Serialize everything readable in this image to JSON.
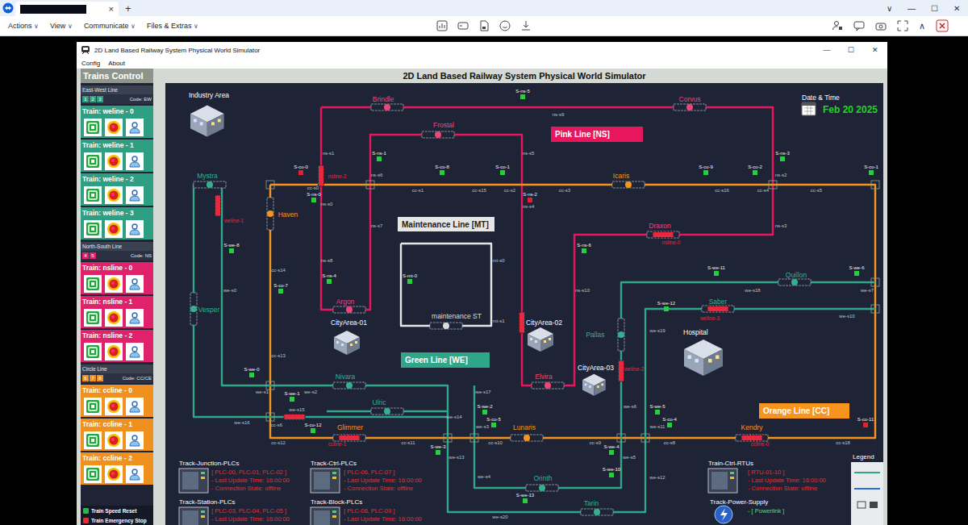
{
  "app_bar": {
    "tab_close": "×",
    "tab_add": "+",
    "window_controls": [
      "∨",
      "—",
      "☐",
      "✕"
    ],
    "menus": [
      {
        "label": "Actions",
        "caret": "∨"
      },
      {
        "label": "View",
        "caret": "∨"
      },
      {
        "label": "Communicate",
        "caret": "∨"
      },
      {
        "label": "Files & Extras",
        "caret": "∨"
      }
    ],
    "collapse": "∧"
  },
  "window": {
    "title": "2D Land Based Railway System Physical World Simulator",
    "controls": [
      "—",
      "☐",
      "✕"
    ],
    "menu": [
      "Config",
      "About"
    ]
  },
  "trains_panel": {
    "title": "Trains Control",
    "groups": [
      {
        "name": "East-West Line",
        "badges": [
          "1",
          "2",
          "3"
        ],
        "code": "Code: EW",
        "color": "#2e9f82",
        "trains": [
          "Train: weline - 0",
          "Train: weline - 1",
          "Train: weline - 2",
          "Train: weline - 3"
        ]
      },
      {
        "name": "North-South Line",
        "badges": [
          "4",
          "5"
        ],
        "code": "Code: NS",
        "color": "#e0226a",
        "trains": [
          "Train: nsline - 0",
          "Train: nsline - 1",
          "Train: nsline - 2"
        ]
      },
      {
        "name": "Circle Line",
        "badges": [
          "6",
          "7",
          "8"
        ],
        "code": "Code: CC/CE",
        "color": "#f0901e",
        "trains": [
          "Train: ccline - 0",
          "Train: ccline - 1",
          "Train: ccline - 2"
        ]
      }
    ],
    "footer": [
      {
        "label": "Train Speed Reset",
        "color": "#2fb34a"
      },
      {
        "label": "Train Emergency Stop",
        "color": "#e03030"
      }
    ]
  },
  "canvas_title": "2D Land Based Railway System Physical World Simulator",
  "map": {
    "lines": [
      {
        "label": "Pink Line [NS]",
        "color": "#e8175d"
      },
      {
        "label": "Orange Line [CC]",
        "color": "#f7941d"
      },
      {
        "label": "Green Line [WE]",
        "color": "#2fa688"
      },
      {
        "label": "Maintenance Line [MT]",
        "color": "#e6e6e6"
      }
    ],
    "stations": [
      {
        "label": "Brindle",
        "color": "#f0437a"
      },
      {
        "label": "Corvus",
        "color": "#f0437a"
      },
      {
        "label": "Frostal",
        "color": "#f0437a"
      },
      {
        "label": "Argon",
        "color": "#f0437a"
      },
      {
        "label": "Elvira",
        "color": "#f0437a"
      },
      {
        "label": "Draxon",
        "color": "#f0437a"
      },
      {
        "label": "Icaris",
        "color": "#f7941d"
      },
      {
        "label": "Haven",
        "color": "#f7941d"
      },
      {
        "label": "Glimmer",
        "color": "#f7941d"
      },
      {
        "label": "Lunaris",
        "color": "#f7941d"
      },
      {
        "label": "Kendry",
        "color": "#f7941d"
      },
      {
        "label": "Mystra",
        "color": "#34b08e"
      },
      {
        "label": "Vesper",
        "color": "#34b08e"
      },
      {
        "label": "Nivara",
        "color": "#34b08e"
      },
      {
        "label": "Ulric",
        "color": "#34b08e"
      },
      {
        "label": "Orinth",
        "color": "#34b08e"
      },
      {
        "label": "Tarin",
        "color": "#34b08e"
      },
      {
        "label": "Pallas",
        "color": "#34b08e"
      },
      {
        "label": "Quillon",
        "color": "#34b08e"
      },
      {
        "label": "Saber",
        "color": "#34b08e"
      },
      {
        "label": "maintenance ST",
        "color": "#dddddd"
      }
    ],
    "trains": [
      {
        "label": "nsline-2",
        "color": "#e8283c"
      },
      {
        "label": "weline-1",
        "color": "#e8283c"
      },
      {
        "label": "nsline-0",
        "color": "#e8283c"
      },
      {
        "color": "#e8283c"
      },
      {
        "color": "#e8283c"
      },
      {
        "label": "weline-2",
        "color": "#e8283c"
      },
      {
        "label": "weline-3",
        "color": "#e8283c"
      },
      {
        "label": "ccline-1",
        "color": "#e8283c"
      },
      {
        "label": "ccline-0",
        "color": "#e8283c"
      }
    ],
    "sensors": [
      {
        "label": "S-ns-5",
        "active": true
      },
      {
        "label": "S-ns-1",
        "active": true
      },
      {
        "label": "S-co-0",
        "active": false
      },
      {
        "label": "S-co-8",
        "active": true
      },
      {
        "label": "S-co-1",
        "active": true
      },
      {
        "label": "S-co-9",
        "active": true
      },
      {
        "label": "S-co-2",
        "active": true
      },
      {
        "label": "S-ns-3",
        "active": true
      },
      {
        "label": "S-co-1",
        "active": true
      },
      {
        "label": "S-ns-0",
        "active": true
      },
      {
        "label": "S-ns-2",
        "active": false
      },
      {
        "label": "S-ns-6",
        "active": true
      },
      {
        "label": "S-ns-4",
        "active": true
      },
      {
        "label": "S-co-7",
        "active": true
      },
      {
        "label": "S-we-8",
        "active": true
      },
      {
        "label": "S-mt-0",
        "active": true
      },
      {
        "label": "S-we-11",
        "active": true
      },
      {
        "label": "S-we-6",
        "active": true
      },
      {
        "label": "S-we-12",
        "active": true
      },
      {
        "label": "S-we-0",
        "active": true
      },
      {
        "label": "S-we-1",
        "active": true
      },
      {
        "label": "S-co-12",
        "active": true
      },
      {
        "label": "S-we-2",
        "active": true
      },
      {
        "label": "S-co-5",
        "active": true
      },
      {
        "label": "S-we-3",
        "active": true
      },
      {
        "label": "S-we-4",
        "active": true
      },
      {
        "label": "S-we-10",
        "active": true
      },
      {
        "label": "S-we-13",
        "active": true
      },
      {
        "label": "S-we-5",
        "active": true
      },
      {
        "label": "S-co-4",
        "active": true
      },
      {
        "label": "S-co-11",
        "active": false
      }
    ],
    "segments": [
      "ns-s9",
      "ns-s1",
      "ns-s5",
      "ns-s2",
      "cc-s0",
      "ns-s0",
      "ns-s6",
      "cc-s1",
      "cc-s15",
      "cc-s2",
      "ns-s4",
      "cc-s3",
      "cc-s16",
      "cc-s4",
      "cc-s5",
      "ns-s7",
      "ns-s3",
      "ns-s8",
      "cc-s14",
      "we-s0",
      "mt-s0",
      "mt-s1",
      "ns-s10",
      "we-s18",
      "we-s7",
      "we-s19",
      "we-s10",
      "cc-s13",
      "we-s1",
      "we-s2",
      "we-s16",
      "cc-s6",
      "we-s15",
      "cc-s12",
      "cc-s11",
      "we-s17",
      "we-s14",
      "we-s3",
      "cc-s10",
      "we-s13",
      "cc-s9",
      "we-s5",
      "we-s4",
      "we-s6",
      "we-s11",
      "cc-s8",
      "we-s12",
      "cc-s18",
      "we-s20"
    ],
    "areas": [
      {
        "label": "Industry Area"
      },
      {
        "label": "CityArea-01"
      },
      {
        "label": "CityArea-02"
      },
      {
        "label": "CityArea-03"
      },
      {
        "label": "Hospital"
      }
    ],
    "date": {
      "label": "Date & Time",
      "value": "Feb 20 2025"
    },
    "panels": [
      {
        "title": "Track-Junction-PLCs",
        "devices": "[ PLC-00, PLC-01, PLC-02 ]",
        "details": [
          "- Last Update Time: 16:00:00",
          "- Connection State: offline"
        ],
        "online": false
      },
      {
        "title": "Track-Ctrl-PLCs",
        "devices": "[ PLC-06, PLC-07 ]",
        "details": [
          "- Last Update Time: 16:00:00",
          "- Connection State: offline"
        ],
        "online": false
      },
      {
        "title": "Train-Ctrl-RTUs",
        "devices": "[ RTU-01-10 ]",
        "details": [
          "- Last Update Time: 16:00:00",
          "- Connection State: offline"
        ],
        "online": false
      },
      {
        "title": "Track-Station-PLCs",
        "devices": "[ PLC-03, PLC-04, PLC-05 ]",
        "details": [
          "- Last Update Time: 16:00:00"
        ],
        "online": false
      },
      {
        "title": "Track-Block-PLCs",
        "devices": "[ PLC-08, PLC-09 ]",
        "details": [
          "- Last Update Time: 16:00:00"
        ],
        "online": false
      },
      {
        "title": "Track-Power-Supply",
        "devices": "- [ Powerlink ]",
        "details": [],
        "online": true
      }
    ],
    "legend": {
      "title": "Legend"
    }
  }
}
